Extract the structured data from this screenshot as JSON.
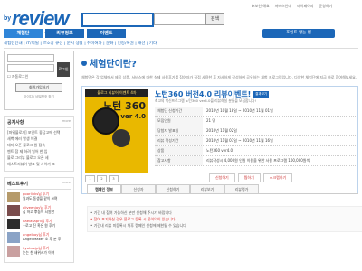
{
  "logo": {
    "by": "by",
    "name": "review",
    "tagline": "REVIEW COMMUNITY"
  },
  "search": {
    "placeholder": "",
    "scope": "",
    "button": "검색"
  },
  "toplinks": [
    "초보안 해요",
    "서비스안내",
    "마이페이지",
    "운영하기"
  ],
  "gnb": [
    {
      "label": "체험단",
      "active": true
    },
    {
      "label": "리뷰정보",
      "active": false
    },
    {
      "label": "이벤트",
      "active": false
    }
  ],
  "promo": "포인트 쌓는 법",
  "subnav": "체험단안내 | IT/지털 | IT소싱 큐션 | 문서 생활 | 취미여가 | 문화 | 건강/복권 | 패션 | 기타",
  "login": {
    "button": "로그인",
    "auto": "자동로그인",
    "join": "회원가입하기",
    "links": "아이디 / 비밀번호 찾기"
  },
  "notice": {
    "title": "공지사항",
    "more": "more",
    "items": [
      "[파워블로거] 포인트 좋답고에 선택",
      "새벽 에러 발생 해결",
      "대저 오픈 블로그 원 접속",
      "벤트 참 제 하려 일어 한 입",
      "블로 그리뷰 블로그 오픈 세",
      "베스트리뷰어 발표 및 사이가 조"
    ]
  },
  "best": {
    "title": "베스트후기",
    "more": "more",
    "items": [
      {
        "user": "poorlinks님 후기",
        "text": "일과도 동생을 같이 쓰며"
      },
      {
        "user": "oliveenjoy님 후기",
        "text": "김 하고 뿌둥이 시원한"
      },
      {
        "user": "daelasapril님 후기",
        "text": "~로고 진 혹은 원 후기"
      },
      {
        "user": "angelboy님 후기",
        "text": "Angel Maker 오 후 분 후"
      },
      {
        "user": "hyoheejp님 후기",
        "text": "눈는 찬 새위서가 이야"
      }
    ]
  },
  "main": {
    "heading": "체험단이란?",
    "intro": "체험단은 각 업체에서 제공 상품, 서비스에 대한 실제 사용후기를 참여자가 직접 사용한 후 자세하게 작성하여 공유하는 체험 프로그램입니다. 다양한 체험단에 지금 바로 참여해보세요.",
    "product": {
      "banner_head": "블로그 리뷰어 이벤트 4차",
      "banner_title": "노턴 360",
      "banner_ver": "ver 4.0",
      "title": "노턴360 버전4.0 리뷰이벤트!",
      "badge": "결과보기",
      "subtitle": "최고의 백신프로그램 노턴360 ver4.0을 리뷰하실 분들을 모집합니다!",
      "rows": [
        {
          "k": "체험단 신청기간",
          "v": "2010년 10월 18일 ~ 2010년 11월 01일"
        },
        {
          "k": "모집인원",
          "v": "21 명"
        },
        {
          "k": "당첨자 발표일",
          "v": "2010년 11월 02일"
        },
        {
          "k": "리뷰 작성기간",
          "v": "2010년 11월 03일 ~ 2010년 11월 16일"
        },
        {
          "k": "상품",
          "v": "노턴360 ver4.0"
        },
        {
          "k": "참고사항",
          "v": "리뷰작성시 4,000원 인원 이용을 위한 사용 프로그램 100,000원씩"
        }
      ],
      "actions": [
        "신청하기",
        "찜하기",
        "스크랩하기"
      ],
      "pager": [
        "1",
        "2",
        "3"
      ]
    }
  },
  "tabs": [
    {
      "label": "캠페인 정보",
      "active": true
    },
    {
      "label": "신청자",
      "active": false
    },
    {
      "label": "신청하기",
      "active": false
    },
    {
      "label": "리뷰보기",
      "active": false
    },
    {
      "label": "리뷰평가",
      "active": false
    }
  ],
  "notes": [
    {
      "text": "• 기간 내 참여 가능하신 분만 신청해 주시기 바랍니다",
      "red": false
    },
    {
      "text": "• 참여 포기하실 경우 블로그 등록 시 불이익이 있습니다",
      "red": true
    },
    {
      "text": "• 기간내 리뷰 미등록시 차후 캠페인 신청에 제한될 수 있습니다",
      "red": false
    }
  ]
}
